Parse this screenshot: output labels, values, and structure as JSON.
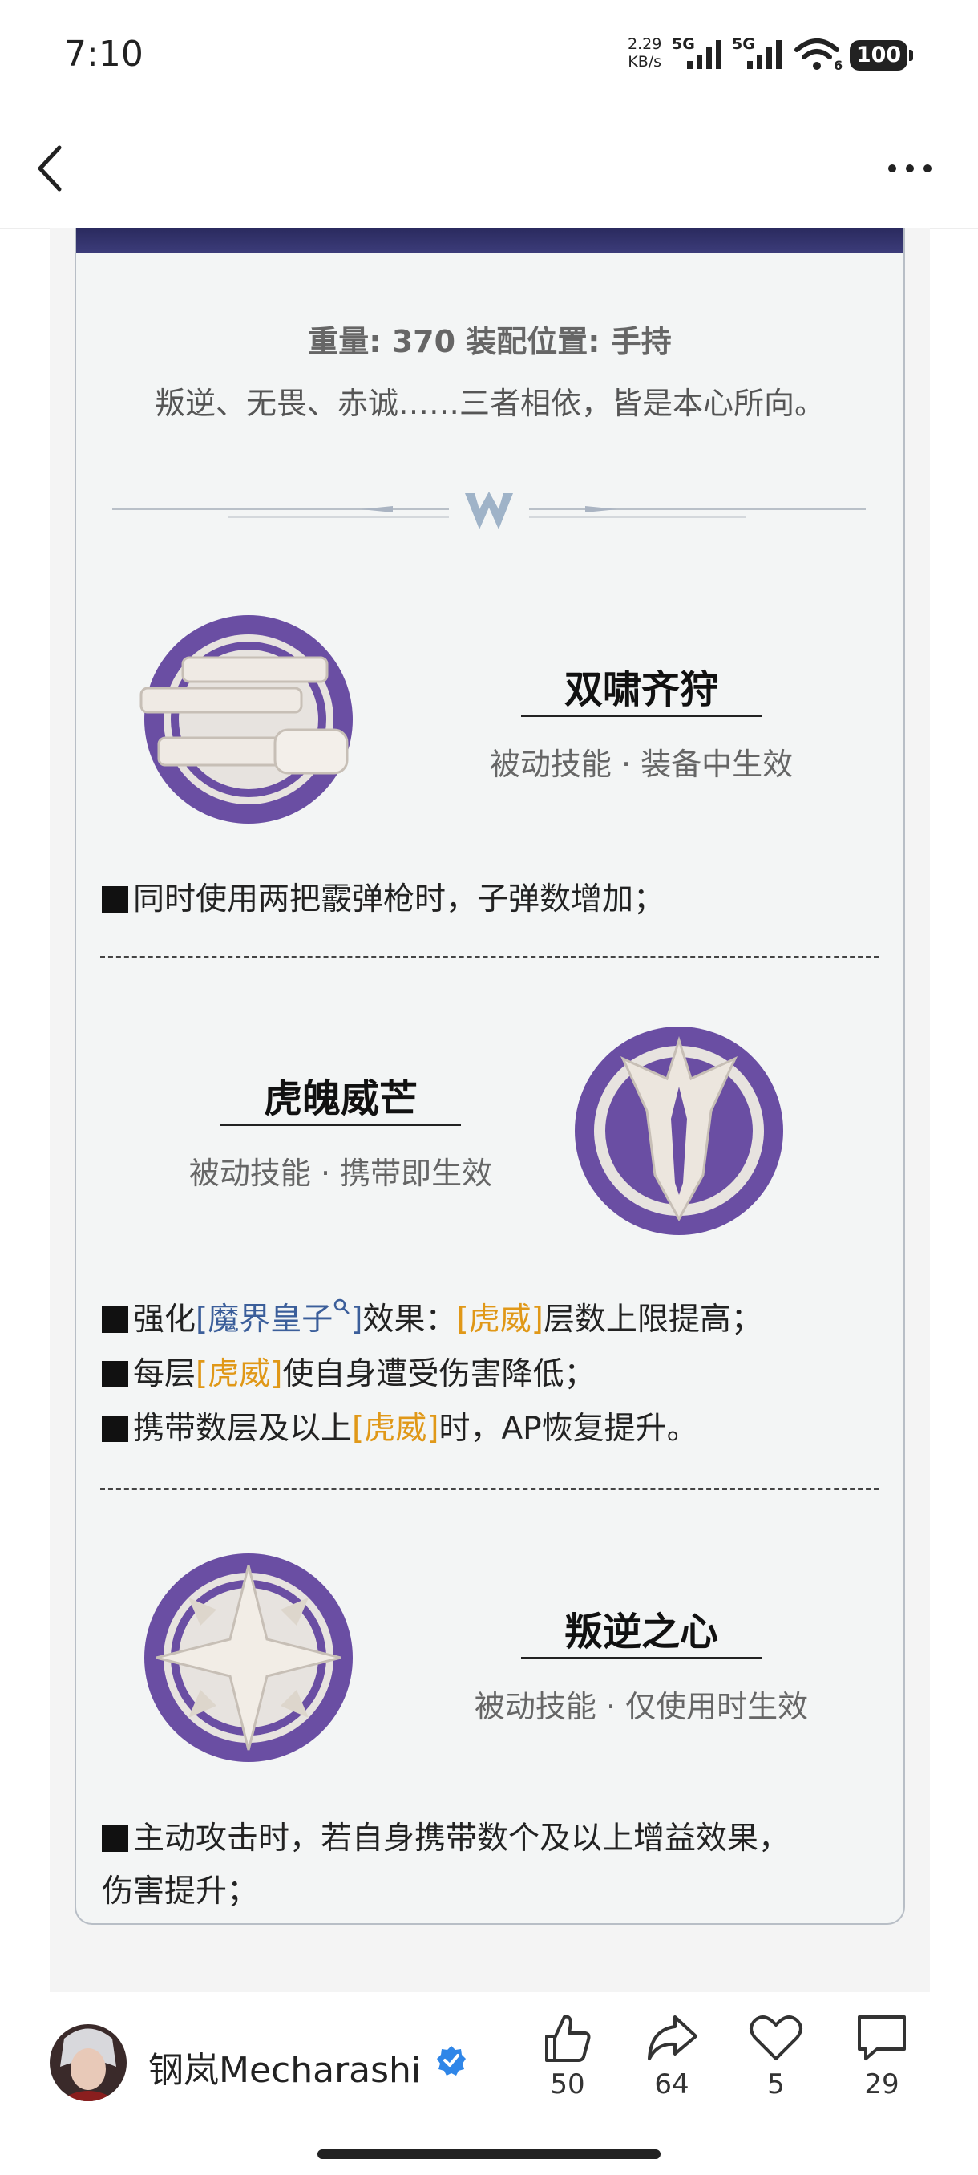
{
  "status_bar": {
    "time": "7:10",
    "net_speed": "2.29",
    "net_unit": "KB/s",
    "sig1": "5G",
    "sig2": "5G",
    "wifi_label": "6",
    "battery": "100"
  },
  "item": {
    "meta": "重量: 370  装配位置: 手持",
    "quote": "叛逆、无畏、赤诚……三者相依，皆是本心所向。"
  },
  "skills": [
    {
      "title": "双啸齐狩",
      "subtitle": "被动技能 · 装备中生效",
      "desc": "同时使用两把霰弹枪时，子弹数增加；"
    },
    {
      "title": "虎魄威芒",
      "subtitle": "被动技能 · 携带即生效",
      "line1_pre": "强化",
      "line1_link": "[魔界皇子",
      "line1_link_end": "]",
      "line1_mid": "效果：",
      "line1_tag": "[虎威]",
      "line1_post": "层数上限提高；",
      "line2_pre": "每层",
      "line2_tag": "[虎威]",
      "line2_post": "使自身遭受伤害降低；",
      "line3_pre": "携带数层及以上",
      "line3_tag": "[虎威]",
      "line3_post": "时，AP恢复提升。"
    },
    {
      "title": "叛逆之心",
      "subtitle": "被动技能 · 仅使用时生效",
      "desc_line1": "主动攻击时，若自身携带数个及以上增益效果，",
      "desc_line2": "伤害提升；"
    }
  ],
  "footer": {
    "author": "钢岚Mecharashi",
    "likes": "50",
    "shares": "64",
    "favorites": "5",
    "comments": "29"
  },
  "colors": {
    "accent_purple": "#6a4ea3",
    "tag_orange": "#e09818",
    "link_blue": "#3b5e9a",
    "verified_blue": "#2f86e8"
  }
}
